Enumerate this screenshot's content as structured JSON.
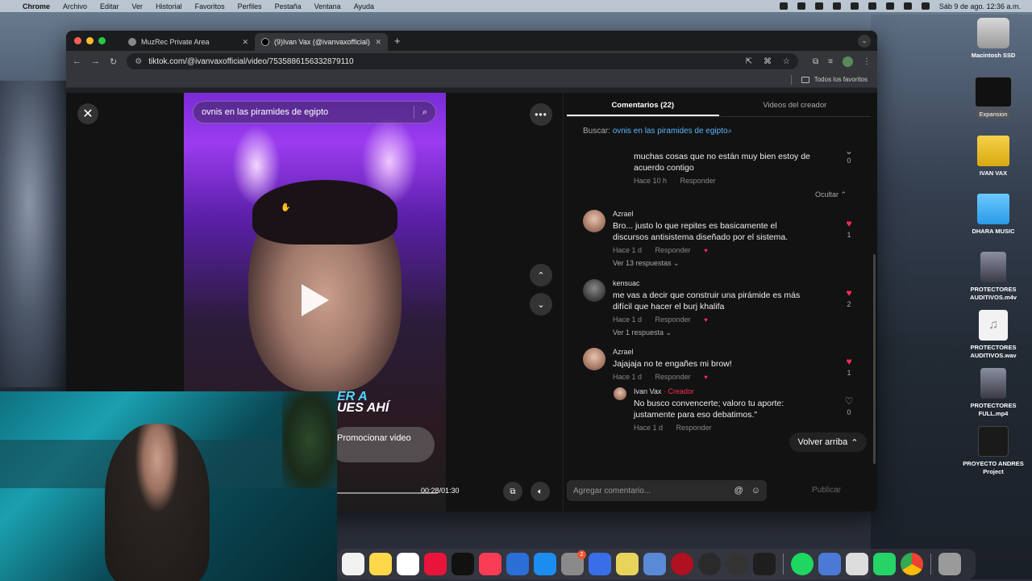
{
  "menubar": {
    "app_name": "Chrome",
    "items": [
      "Archivo",
      "Editar",
      "Ver",
      "Historial",
      "Favoritos",
      "Perfiles",
      "Pestaña",
      "Ventana",
      "Ayuda"
    ],
    "datetime": "Sáb 9 de ago. 12:36 a.m."
  },
  "browser": {
    "tabs": [
      {
        "title": "MuzRec Private Area",
        "active": false
      },
      {
        "title": "(9)Ivan Vax (@ivanvaxofficial)",
        "active": true
      }
    ],
    "url": "tiktok.com/@ivanvaxofficial/video/7535886156332879110",
    "bookmarks_folder": "Todos los favoritos"
  },
  "video": {
    "search_value": "ovnis en las piramides de egipto",
    "overlay_line1": "ER A",
    "overlay_line2": "UES AHÍ",
    "promote_label": "Promocionar video",
    "time": "00:28/01:30"
  },
  "comments_panel": {
    "tab_comments": "Comentarios (22)",
    "tab_videos": "Videos del creador",
    "search_prefix": "Buscar:",
    "search_query": "ovnis en las piramides de egipto",
    "hide_label": "Ocultar",
    "back_to_top": "Volver arriba",
    "add_placeholder": "Agregar comentario...",
    "publish": "Publicar",
    "comments": [
      {
        "user": "",
        "text": "muchas cosas que no están muy bien estoy de acuerdo contigo",
        "time": "Hace 10 h",
        "reply": "Responder",
        "likes": "0"
      },
      {
        "user": "Azrael",
        "text": "Bro... justo lo que repites es basicamente el discursos antisistema diseñado por el sistema.",
        "time": "Hace 1 d",
        "reply": "Responder",
        "likes": "1",
        "more": "Ver 13 respuestas"
      },
      {
        "user": "kensuac",
        "text": "me vas a decir que construir una pirámide es más difícil que hacer el burj khalifa",
        "time": "Hace 1 d",
        "reply": "Responder",
        "likes": "2",
        "more": "Ver 1 respuesta"
      },
      {
        "user": "Azrael",
        "text": "Jajajaja no te engañes mi brow!",
        "time": "Hace 1 d",
        "reply": "Responder",
        "likes": "1"
      },
      {
        "user": "Ivan Vax",
        "creator": "· Creador",
        "text": "No busco convencerte; valoro tu aporte: justamente para eso debatimos.\"",
        "time": "Hace 1 d",
        "reply": "Responder",
        "likes": "0"
      }
    ]
  },
  "desktop_icons": [
    {
      "label": "Macintosh SSD"
    },
    {
      "label": "Expansion"
    },
    {
      "label": "IVAN VAX"
    },
    {
      "label": "DHARA MUSIC"
    },
    {
      "label": "PROTECTORES AUDITIVOS.m4v"
    },
    {
      "label": "PROTECTORES AUDITIVOS.wav"
    },
    {
      "label": "PROTECTORES FULL.mp4"
    },
    {
      "label": "PROYECTO ANDRES Project"
    }
  ],
  "dock": {
    "badge_count": "2"
  },
  "colors": {
    "tiktok_red": "#fe2c55",
    "link_blue": "#5ab6ff"
  }
}
